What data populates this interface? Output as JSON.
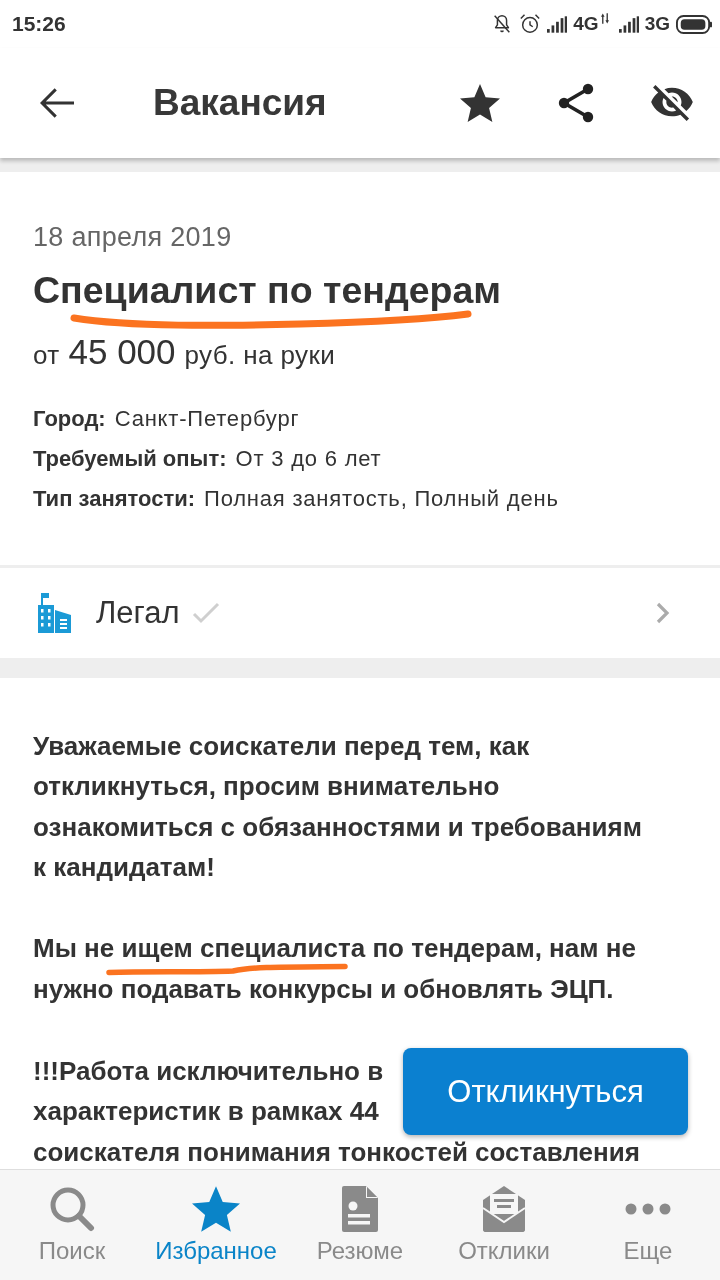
{
  "status_bar": {
    "time": "15:26",
    "network_1": "4G",
    "network_2": "3G"
  },
  "toolbar": {
    "title": "Вакансия"
  },
  "vacancy": {
    "date": "18 апреля 2019",
    "title": "Специалист по тендерам",
    "salary": {
      "prefix": "от",
      "amount": "45 000",
      "suffix": "руб. на руки"
    },
    "details": [
      {
        "label": "Город:",
        "value": "Санкт-Петербург"
      },
      {
        "label": "Требуемый опыт:",
        "value": "От 3 до 6 лет"
      },
      {
        "label": "Тип занятости:",
        "value": "Полная занятость, Полный день"
      }
    ]
  },
  "company": {
    "name": "Легал"
  },
  "description": {
    "paragraphs": [
      "Уважаемые соискатели перед тем, как откликнуться, просим внимательно ознакомиться с обязанностями и требованиям к кандидатам!"
    ],
    "underlined_paragraph_lines": [
      "Мы не ищем специалиста по тендерам, нам не",
      "нужно подавать конкурсы и обновлять ЭЦП."
    ],
    "covered_paragraph_lines": [
      "!!!Работа исключительно в",
      "характеристик в рамках 44",
      "соискателя понимания тонкостей составления"
    ]
  },
  "apply_button": {
    "label": "Откликнуться"
  },
  "bottom_nav": [
    {
      "kind": "search",
      "label": "Поиск",
      "selected": false
    },
    {
      "kind": "star",
      "label": "Избранное",
      "selected": true
    },
    {
      "kind": "document",
      "label": "Резюме",
      "selected": false
    },
    {
      "kind": "mail",
      "label": "Отклики",
      "selected": false
    },
    {
      "kind": "more",
      "label": "Еще",
      "selected": false
    }
  ]
}
